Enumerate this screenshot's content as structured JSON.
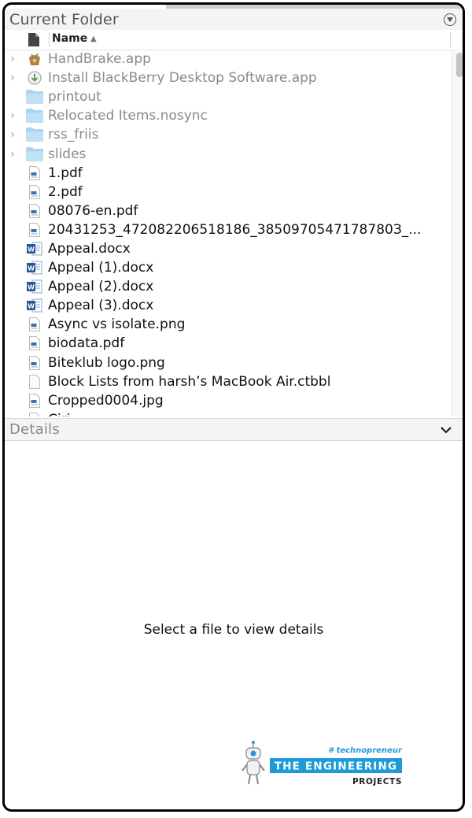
{
  "current_folder": {
    "title": "Current Folder",
    "column_name": "Name",
    "sort_indicator": "▲"
  },
  "files": [
    {
      "name": "HandBrake.app",
      "icon": "app-icon",
      "expandable": true,
      "dim": true
    },
    {
      "name": "Install BlackBerry Desktop Software.app",
      "icon": "installer-icon",
      "expandable": true,
      "dim": true
    },
    {
      "name": "printout",
      "icon": "folder-icon",
      "expandable": false,
      "dim": true
    },
    {
      "name": "Relocated Items.nosync",
      "icon": "folder-icon",
      "expandable": true,
      "dim": true
    },
    {
      "name": "rss_friis",
      "icon": "folder-icon",
      "expandable": true,
      "dim": true
    },
    {
      "name": "slides",
      "icon": "folder-icon",
      "expandable": true,
      "dim": true
    },
    {
      "name": "1.pdf",
      "icon": "document-icon",
      "expandable": false,
      "dim": false
    },
    {
      "name": "2.pdf",
      "icon": "document-icon",
      "expandable": false,
      "dim": false
    },
    {
      "name": "08076-en.pdf",
      "icon": "document-icon",
      "expandable": false,
      "dim": false
    },
    {
      "name": "20431253_472082206518186_3850970547178780З_...",
      "icon": "document-icon",
      "expandable": false,
      "dim": false
    },
    {
      "name": "Appeal.docx",
      "icon": "word-icon",
      "expandable": false,
      "dim": false
    },
    {
      "name": "Appeal (1).docx",
      "icon": "word-icon",
      "expandable": false,
      "dim": false
    },
    {
      "name": "Appeal (2).docx",
      "icon": "word-icon",
      "expandable": false,
      "dim": false
    },
    {
      "name": "Appeal (3).docx",
      "icon": "word-icon",
      "expandable": false,
      "dim": false
    },
    {
      "name": "Async vs isolate.png",
      "icon": "document-icon",
      "expandable": false,
      "dim": false
    },
    {
      "name": "biodata.pdf",
      "icon": "document-icon",
      "expandable": false,
      "dim": false
    },
    {
      "name": "Biteklub logo.png",
      "icon": "document-icon",
      "expandable": false,
      "dim": false
    },
    {
      "name": "Block Lists from harsh’s MacBook Air.ctbbl",
      "icon": "blank-file-icon",
      "expandable": false,
      "dim": false
    },
    {
      "name": "Cropped0004.jpg",
      "icon": "document-icon",
      "expandable": false,
      "dim": false
    },
    {
      "name": "Ciri...",
      "icon": "document-icon",
      "expandable": false,
      "dim": false
    }
  ],
  "details": {
    "title": "Details",
    "empty_message": "Select a file to view details"
  },
  "watermark": {
    "tagline": "# technopreneur",
    "line1": "THE ENGINEERING",
    "line2": "PROJECTS"
  },
  "colors": {
    "folder": "#a9d3ef",
    "word": "#2b579a",
    "header_bg": "#f4f4f4",
    "watermark_blue": "#1e9bd7"
  }
}
